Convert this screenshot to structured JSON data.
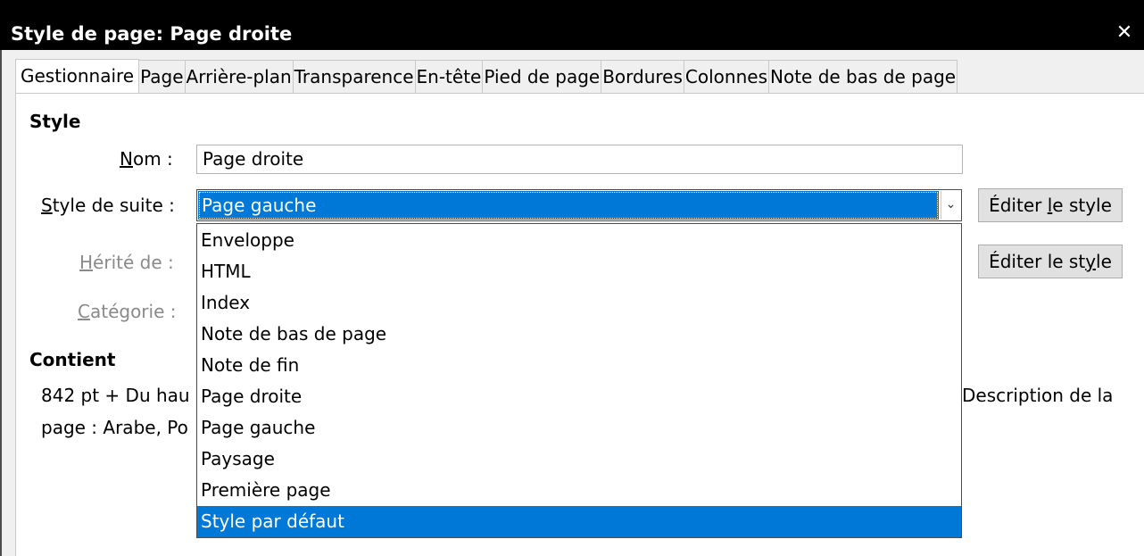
{
  "window": {
    "title": "Style de page: Page droite",
    "close_glyph": "✕"
  },
  "tabs": [
    {
      "label": "Gestionnaire",
      "active": true
    },
    {
      "label": "Page"
    },
    {
      "label": "Arrière-plan"
    },
    {
      "label": "Transparence"
    },
    {
      "label": "En-tête"
    },
    {
      "label": "Pied de page"
    },
    {
      "label": "Bordures"
    },
    {
      "label": "Colonnes"
    },
    {
      "label": "Note de bas de page"
    }
  ],
  "style_section": {
    "heading": "Style",
    "name_label_mnemonic": "N",
    "name_label_rest": "om :",
    "name_value": "Page droite",
    "next_style_label_mnemonic": "S",
    "next_style_label_rest": "tyle de suite :",
    "next_style_value": "Page gauche",
    "inherit_label_mnemonic": "H",
    "inherit_label_rest": "érité de :",
    "category_label_mnemonic": "C",
    "category_label_rest": "atégorie :",
    "edit_button_1_pre": "Éditer ",
    "edit_button_1_mnemonic": "l",
    "edit_button_1_post": "e style",
    "edit_button_2_pre": "Éditer le st",
    "edit_button_2_mnemonic": "y",
    "edit_button_2_post": "le"
  },
  "dropdown": {
    "items": [
      "Enveloppe",
      "HTML",
      "Index",
      "Note de bas de page",
      "Note de fin",
      "Page droite",
      "Page gauche",
      "Paysage",
      "Première page",
      "Style par défaut"
    ],
    "highlighted": "Style par défaut"
  },
  "contains_section": {
    "heading": "Contient",
    "line1_left": "842 pt + Du hau",
    "line1_right": "Description de la",
    "line2_left": "page : Arabe, Po"
  },
  "colors": {
    "accent": "#0078d7",
    "titlebar": "#000000",
    "disabled_text": "#8a8a8a"
  }
}
